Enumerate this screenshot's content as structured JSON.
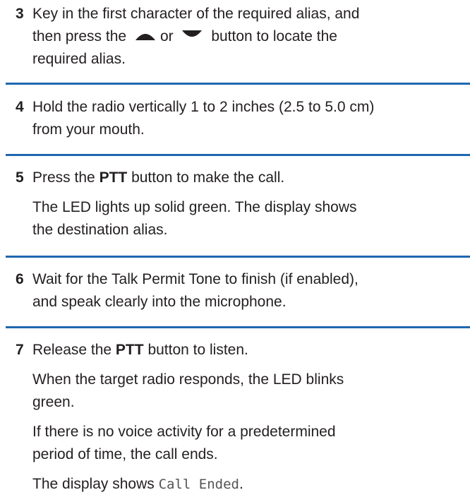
{
  "steps": [
    {
      "number": "3",
      "lines": [
        {
          "before": "Key in the first character of the required alias, and"
        },
        {
          "before": "then press the",
          "icon1": "up-arrow-icon",
          "mid": "or",
          "icon2": "down-arrow-icon",
          "after": "button to locate the"
        },
        {
          "before": "required alias."
        }
      ]
    },
    {
      "number": "4",
      "lines": [
        {
          "before": "Hold the radio vertically 1 to 2 inches (2.5 to 5.0 cm)"
        },
        {
          "before": "from your mouth."
        }
      ]
    },
    {
      "number": "5",
      "paragraphs": [
        {
          "before": "Press the",
          "bold": "PTT",
          "after": "button to make the call."
        },
        {
          "line1": "The LED lights up solid green. The display shows",
          "line2": "the destination alias."
        }
      ]
    },
    {
      "number": "6",
      "lines": [
        {
          "before": "Wait for the Talk Permit Tone to finish (if enabled),"
        },
        {
          "before": "and speak clearly into the microphone."
        }
      ]
    },
    {
      "number": "7",
      "paragraphs": [
        {
          "before": "Release the",
          "bold": "PTT",
          "after": "button to listen."
        },
        {
          "line1": "When the target radio responds, the LED blinks",
          "line2": "green."
        },
        {
          "line1": "If there is no voice activity for a predetermined",
          "line2": "period of time, the call ends."
        },
        {
          "before": "The display shows",
          "mono": "Call Ended",
          "after": "."
        }
      ]
    }
  ],
  "colors": {
    "rule": "#1f67b0",
    "text": "#231f20"
  }
}
